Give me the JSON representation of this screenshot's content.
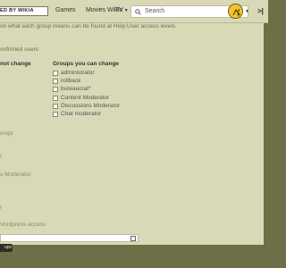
{
  "topbar": {
    "logo_text": "ED BY WIKIA",
    "nav": [
      "Games",
      "Movies",
      "TV",
      "Wikis"
    ],
    "search_placeholder": "Search",
    "accent": "#f4c430",
    "icons": [
      "search-icon",
      "chevron-down-icon",
      "avatar",
      "rail-toggle-icon"
    ]
  },
  "content": {
    "info_line": "on what each group means can be found at Help:User access levels",
    "unconfirmed": "onfirmed users",
    "cannot_change_header": "not change",
    "can_change_header": "Groups you can change",
    "groups": [
      {
        "label": "administrator",
        "checked": false
      },
      {
        "label": "rollback",
        "checked": false
      },
      {
        "label": "bureaucrat*",
        "checked": false
      },
      {
        "label": "Content Moderator",
        "checked": false
      },
      {
        "label": "Discussions Moderator",
        "checked": false
      },
      {
        "label": "Chat moderator",
        "checked": false
      }
    ],
    "left_fragments": [
      "empt",
      "r",
      "s Moderator",
      "r",
      "Vordpress access"
    ],
    "reason_value": "",
    "save_label": "ups"
  }
}
